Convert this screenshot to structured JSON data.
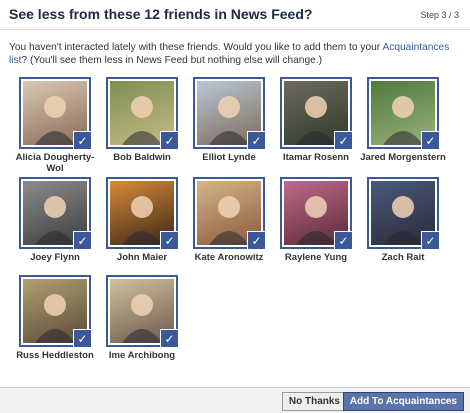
{
  "dialog": {
    "title": "See less from these 12 friends in News Feed?",
    "step": "Step 3 / 3",
    "intro_before": "You haven't interacted lately with these friends. Would you like to add them to your ",
    "intro_link": "Acquaintances list",
    "intro_after": "? (You'll see them less in News Feed but nothing else will change.)"
  },
  "check_glyph": "✓",
  "friends": [
    {
      "name": "Alicia Dougherty-Wol",
      "colors": [
        "#d9c9b8",
        "#8a6a55"
      ]
    },
    {
      "name": "Bob Baldwin",
      "colors": [
        "#7d8f4f",
        "#c8b98a"
      ]
    },
    {
      "name": "Elliot Lynde",
      "colors": [
        "#b9c7d6",
        "#7d6b5a"
      ]
    },
    {
      "name": "Itamar Rosenn",
      "colors": [
        "#6e6a5f",
        "#2e3a2a"
      ]
    },
    {
      "name": "Jared Morgenstern",
      "colors": [
        "#4f7a3a",
        "#9ab07a"
      ]
    },
    {
      "name": "Joey Flynn",
      "colors": [
        "#8c8c8c",
        "#3d3d3d"
      ]
    },
    {
      "name": "John Maier",
      "colors": [
        "#d98a3a",
        "#3a2718"
      ]
    },
    {
      "name": "Kate Aronowitz",
      "colors": [
        "#d6b48a",
        "#8a5a3a"
      ]
    },
    {
      "name": "Raylene Yung",
      "colors": [
        "#c06a8a",
        "#5a2a3a"
      ]
    },
    {
      "name": "Zach Rait",
      "colors": [
        "#4a5a7a",
        "#2a2a3a"
      ]
    },
    {
      "name": "Russ Heddleston",
      "colors": [
        "#b0a070",
        "#5a4a3a"
      ]
    },
    {
      "name": "Ime Archibong",
      "colors": [
        "#d0c0a0",
        "#6a5a4a"
      ]
    }
  ],
  "buttons": {
    "no_thanks": "No Thanks",
    "add": "Add To Acquaintances"
  },
  "colors": {
    "accent": "#3b5998",
    "primary_button": "#5b74a8"
  }
}
